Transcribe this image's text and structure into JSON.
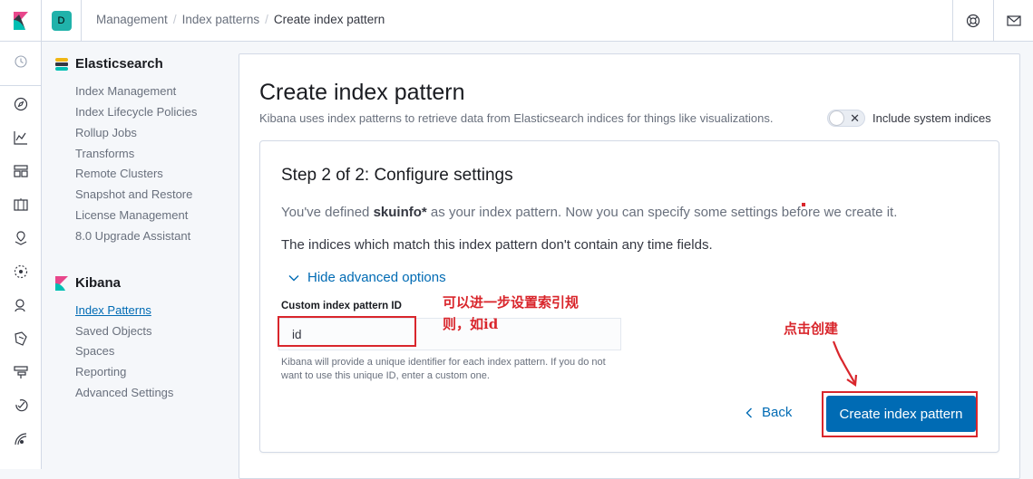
{
  "header": {
    "space_initial": "D",
    "breadcrumbs": [
      "Management",
      "Index patterns",
      "Create index pattern"
    ]
  },
  "sidenav": {
    "sections": [
      {
        "title": "Elasticsearch",
        "items": [
          "Index Management",
          "Index Lifecycle Policies",
          "Rollup Jobs",
          "Transforms",
          "Remote Clusters",
          "Snapshot and Restore",
          "License Management",
          "8.0 Upgrade Assistant"
        ]
      },
      {
        "title": "Kibana",
        "items": [
          "Index Patterns",
          "Saved Objects",
          "Spaces",
          "Reporting",
          "Advanced Settings"
        ],
        "active": "Index Patterns"
      }
    ]
  },
  "main": {
    "title": "Create index pattern",
    "description": "Kibana uses index patterns to retrieve data from Elasticsearch indices for things like visualizations.",
    "system_indices_label": "Include system indices",
    "system_indices_on": false,
    "step": {
      "title": "Step 2 of 2: Configure settings",
      "defined_prefix": "You've defined ",
      "pattern": "skuinfo*",
      "defined_suffix": " as your index pattern. Now you can specify some settings before we create it.",
      "no_time_fields": "The indices which match this index pattern don't contain any time fields.",
      "advanced_toggle": "Hide advanced options",
      "custom_id_label": "Custom index pattern ID",
      "custom_id_value": "id",
      "custom_id_help": "Kibana will provide a unique identifier for each index pattern. If you do not want to use this unique ID, enter a custom one.",
      "back_label": "Back",
      "create_label": "Create index pattern"
    }
  },
  "annotations": {
    "note_id_line1": "可以进一步设置索引规",
    "note_id_line2": "则，如id",
    "note_create": "点击创建",
    "color": "#d9262c"
  },
  "colors": {
    "primary": "#006bb4",
    "kibana_teal": "#20b2aa"
  }
}
